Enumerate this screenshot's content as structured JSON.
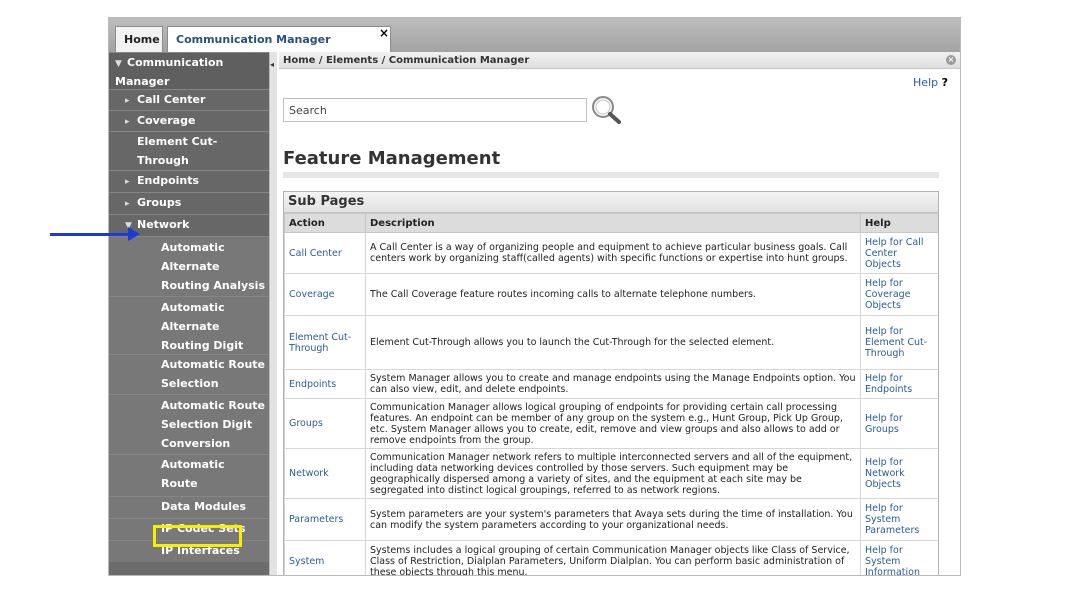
{
  "tabs": {
    "home": "Home",
    "active": "Communication Manager",
    "close_glyph": "×"
  },
  "sidebar": {
    "items": [
      {
        "label": "Communication Manager",
        "caret": "▼"
      },
      {
        "label": "Call Center",
        "caret": "▸"
      },
      {
        "label": "Coverage",
        "caret": "▸"
      },
      {
        "label": "Element Cut-Through",
        "caret": ""
      },
      {
        "label": "Endpoints",
        "caret": "▸"
      },
      {
        "label": "Groups",
        "caret": "▸"
      },
      {
        "label": "Network",
        "caret": "▼"
      },
      {
        "label": "Automatic Alternate Routing Analysis"
      },
      {
        "label": "Automatic Alternate Routing Digit Conversion"
      },
      {
        "label": "Automatic Route Selection Analysis"
      },
      {
        "label": "Automatic Route Selection Digit Conversion"
      },
      {
        "label": "Automatic Route Selection Toll"
      },
      {
        "label": "Data Modules"
      },
      {
        "label": "IP Codec Sets"
      },
      {
        "label": "IP Interfaces"
      }
    ]
  },
  "breadcrumb": "Home / Elements / Communication Manager",
  "help_top": {
    "label": "Help",
    "mark": "?"
  },
  "search": {
    "placeholder": "Search"
  },
  "page_title": "Feature Management",
  "subpages": {
    "title": "Sub Pages",
    "columns": [
      "Action",
      "Description",
      "Help"
    ],
    "rows": [
      {
        "action": "Call Center",
        "description": "A Call Center is a way of organizing people and equipment to achieve particular business goals. Call centers work by organizing staff(called agents) with specific functions or expertise into hunt groups.",
        "help": "Help for Call Center Objects"
      },
      {
        "action": "Coverage",
        "description": "The Call Coverage feature routes incoming calls to alternate telephone numbers.",
        "help": "Help for Coverage Objects"
      },
      {
        "action": "Element Cut-Through",
        "description": "Element Cut-Through allows you to launch the Cut-Through for the selected element.",
        "help": "Help for Element Cut-Through"
      },
      {
        "action": "Endpoints",
        "description": "System Manager allows you to create and manage endpoints using the Manage Endpoints option. You can also view, edit, and delete endpoints.",
        "help": "Help for Endpoints"
      },
      {
        "action": "Groups",
        "description": "Communication Manager allows logical grouping of endpoints for providing certain call processing features. An endpoint can be member of any group on the system e.g., Hunt Group, Pick Up Group, etc. System Manager allows you to create, edit, remove and view groups and also allows to add or remove endpoints from the group.",
        "help": "Help for Groups"
      },
      {
        "action": "Network",
        "description": "Communication Manager network refers to multiple interconnected servers and all of the equipment, including data networking devices controlled by those servers. Such equipment may be geographically dispersed among a variety of sites, and the equipment at each site may be segregated into distinct logical groupings, referred to as network regions.",
        "help": "Help for Network Objects"
      },
      {
        "action": "Parameters",
        "description": "System parameters are your system's parameters that Avaya sets during the time of installation. You can modify the system parameters according to your organizational needs.",
        "help": "Help for System Parameters"
      },
      {
        "action": "System",
        "description": "Systems includes a logical grouping of certain Communication Manager objects like Class of Service, Class of Restriction, Dialplan Parameters, Uniform Dialplan. You can perform basic administration of these objects through this menu.",
        "help": "Help for System Information"
      }
    ]
  },
  "colors": {
    "link": "#2b5c9a",
    "sidebar_bg": "#6c6c6c",
    "annotation_arrow": "#1a3bd6",
    "annotation_highlight": "#f6f000"
  }
}
